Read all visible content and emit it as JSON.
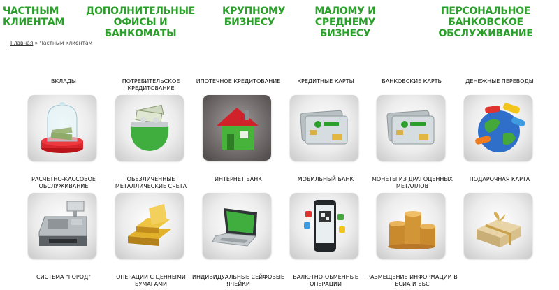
{
  "nav": {
    "private": "ЧАСТНЫМ\nКЛИЕНТАМ",
    "offices": "ДОПОЛНИТЕЛЬНЫЕ ОФИСЫ И\nБАНКОМАТЫ",
    "large": "КРУПНОМУ\nБИЗНЕСУ",
    "small": "МАЛОМУ И СРЕДНЕМУ\nБИЗНЕСУ",
    "personal": "ПЕРСОНАЛЬНОЕ БАНКОВСКОЕ\nОБСЛУЖИВАНИЕ"
  },
  "breadcrumb": {
    "home": "Главная",
    "separator": " » ",
    "current": "Частным клиентам"
  },
  "accent_color": "#2aa02a",
  "services": {
    "r1": [
      {
        "label": "ВКЛАДЫ",
        "icon": "glass-jar-money-icon"
      },
      {
        "label": "ПОТРЕБИТЕЛЬСКОЕ\nКРЕДИТОВАНИЕ",
        "icon": "wallet-money-icon"
      },
      {
        "label": "ИПОТЕЧНОЕ КРЕДИТОВАНИЕ",
        "icon": "house-icon"
      },
      {
        "label": "КРЕДИТНЫЕ КАРТЫ",
        "icon": "credit-card-icon"
      },
      {
        "label": "БАНКОВСКИЕ КАРТЫ",
        "icon": "bank-card-icon"
      },
      {
        "label": "ДЕНЕЖНЫЕ ПЕРЕВОДЫ",
        "icon": "globe-transfer-icon"
      }
    ],
    "r2": [
      {
        "label": "РАСЧЕТНО-КАССОВОЕ\nОБСЛУЖИВАНИЕ",
        "icon": "cash-register-icon"
      },
      {
        "label": "ОБЕЗЛИЧЕННЫЕ\nМЕТАЛЛИЧЕСКИЕ СЧЕТА",
        "icon": "gold-bars-icon"
      },
      {
        "label": "ИНТЕРНЕТ БАНК",
        "icon": "laptop-icon"
      },
      {
        "label": "МОБИЛЬНЫЙ БАНК",
        "icon": "smartphone-icon"
      },
      {
        "label": "МОНЕТЫ ИЗ ДРАГОЦЕННЫХ\nМЕТАЛЛОВ",
        "icon": "coins-stack-icon"
      },
      {
        "label": "ПОДАРОЧНАЯ КАРТА",
        "icon": "gift-box-icon"
      }
    ],
    "r3": [
      {
        "label": "СИСТЕМА \"ГОРОД\""
      },
      {
        "label": "ОПЕРАЦИИ С ЦЕННЫМИ\nБУМАГАМИ"
      },
      {
        "label": "ИНДИВИДУАЛЬНЫЕ СЕЙФОВЫЕ\nЯЧЕЙКИ"
      },
      {
        "label": "ВАЛЮТНО-ОБМЕННЫЕ\nОПЕРАЦИИ"
      },
      {
        "label": "РАЗМЕЩЕНИЕ ИНФОРМАЦИИ В\nЕСИА И ЕБС"
      }
    ]
  }
}
